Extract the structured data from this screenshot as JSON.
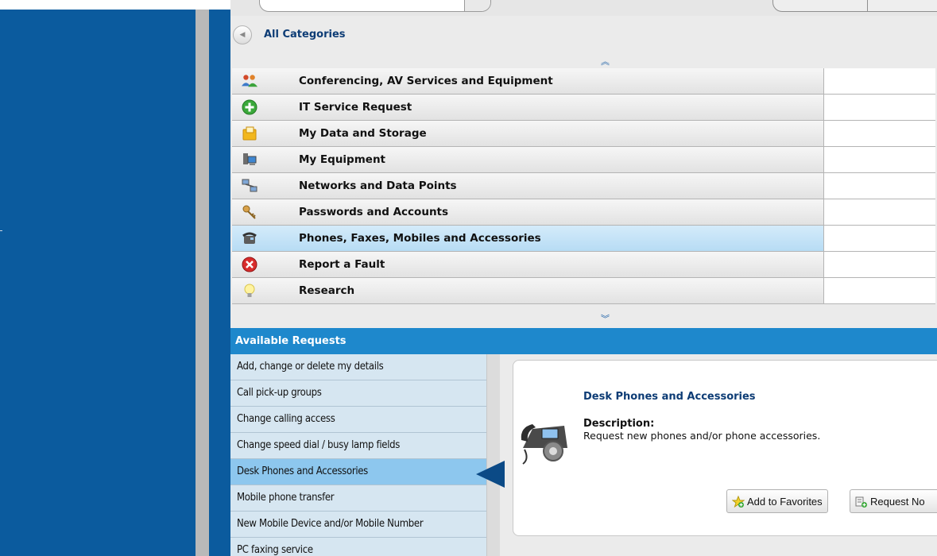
{
  "header": {
    "all_categories": "All Categories"
  },
  "categories": [
    {
      "label": "Conferencing, AV Services and Equipment",
      "icon": "people-icon"
    },
    {
      "label": "IT Service Request",
      "icon": "green-plus-icon"
    },
    {
      "label": "My Data and Storage",
      "icon": "folder-icon"
    },
    {
      "label": "My Equipment",
      "icon": "computer-icon"
    },
    {
      "label": "Networks and Data Points",
      "icon": "network-icon"
    },
    {
      "label": "Passwords and Accounts",
      "icon": "keys-icon"
    },
    {
      "label": "Phones, Faxes, Mobiles and Accessories",
      "icon": "phone-icon",
      "selected": true
    },
    {
      "label": "Report a Fault",
      "icon": "red-x-icon"
    },
    {
      "label": "Research",
      "icon": "lightbulb-icon"
    }
  ],
  "available_requests": {
    "heading": "Available Requests",
    "items": [
      "Add, change or delete my details",
      "Call pick-up groups",
      "Change calling access",
      "Change speed dial / busy lamp fields",
      "Desk Phones and Accessories",
      "Mobile phone transfer",
      "New Mobile Device and/or Mobile Number",
      "PC faxing service"
    ],
    "selected_index": 4
  },
  "detail": {
    "title": "Desk Phones and Accessories",
    "description_label": "Description:",
    "description": "Request new phones and/or phone accessories.",
    "add_favorites": "Add to Favorites",
    "request_now": "Request No"
  },
  "colors": {
    "brand_blue": "#0b5b9e",
    "header_blue": "#1e88cc",
    "selected_row": "#8dc7ee",
    "title_text": "#0d3c75"
  }
}
